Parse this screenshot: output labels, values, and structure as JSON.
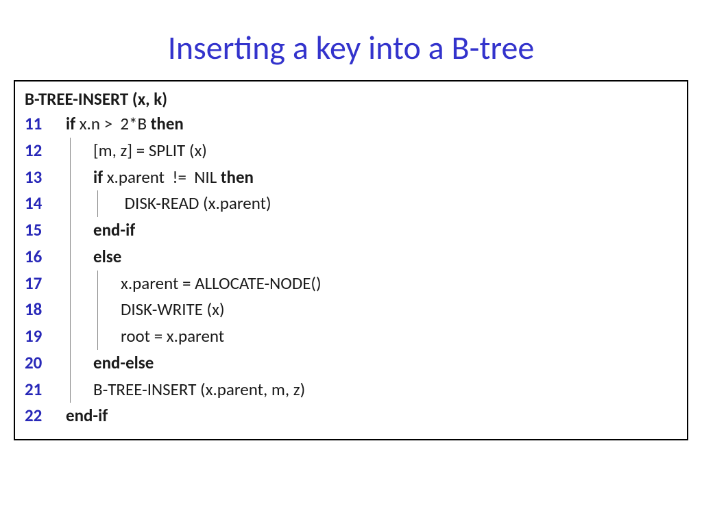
{
  "title": "Inserting a key into a B-tree",
  "func_header": "B-TREE-INSERT (x, k)",
  "lines": {
    "l11": {
      "no": "11",
      "kw1": "if ",
      "t1": "x.n >  2*B ",
      "kw2": "then"
    },
    "l12": {
      "no": "12",
      "t1": "[m, z] = SPLIT (x)"
    },
    "l13": {
      "no": "13",
      "kw1": "if ",
      "t1": "x.parent  !=  NIL ",
      "kw2": "then"
    },
    "l14": {
      "no": "14",
      "t1": " DISK-READ (x.parent)"
    },
    "l15": {
      "no": "15",
      "kw1": "end-if"
    },
    "l16": {
      "no": "16",
      "kw1": "else"
    },
    "l17": {
      "no": "17",
      "t1": "x.parent = ALLOCATE-NODE()"
    },
    "l18": {
      "no": "18",
      "t1": "DISK-WRITE (x)"
    },
    "l19": {
      "no": "19",
      "t1": "root = x.parent"
    },
    "l20": {
      "no": "20",
      "kw1": "end-else"
    },
    "l21": {
      "no": "21",
      "t1": "B-TREE-INSERT (x.parent, m, z)"
    },
    "l22": {
      "no": "22",
      "kw1": "end-if"
    }
  }
}
